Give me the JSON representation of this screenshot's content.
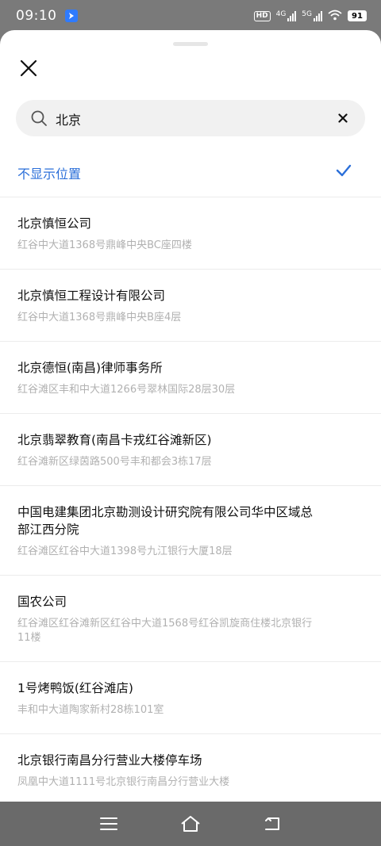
{
  "status_bar": {
    "time": "09:10",
    "hd": "HD",
    "net1": "4G",
    "net2": "5G",
    "battery": "91"
  },
  "search": {
    "value": "北京"
  },
  "none_option": {
    "label": "不显示位置",
    "selected": true
  },
  "results": [
    {
      "name": "北京慎恒公司",
      "address": "红谷中大道1368号鼎峰中央BC座四楼"
    },
    {
      "name": "北京慎恒工程设计有限公司",
      "address": "红谷中大道1368号鼎峰中央B座4层"
    },
    {
      "name": "北京德恒(南昌)律师事务所",
      "address": "红谷滩区丰和中大道1266号翠林国际28层30层"
    },
    {
      "name": "北京翡翠教育(南昌卡戎红谷滩新区)",
      "address": "红谷滩新区绿茵路500号丰和都会3栋17层"
    },
    {
      "name": "中国电建集团北京勘测设计研究院有限公司华中区域总部江西分院",
      "address": "红谷滩区红谷中大道1398号九江银行大厦18层"
    },
    {
      "name": "国农公司",
      "address": "红谷滩区红谷滩新区红谷中大道1568号红谷凯旋商住楼北京银行11楼"
    },
    {
      "name": "1号烤鸭饭(红谷滩店)",
      "address": "丰和中大道陶家新村28栋101室"
    },
    {
      "name": "北京银行南昌分行营业大楼停车场",
      "address": "凤凰中大道1111号北京银行南昌分行营业大楼"
    }
  ],
  "colors": {
    "accent": "#2b6fd9",
    "address_text": "#b1b1b1"
  }
}
